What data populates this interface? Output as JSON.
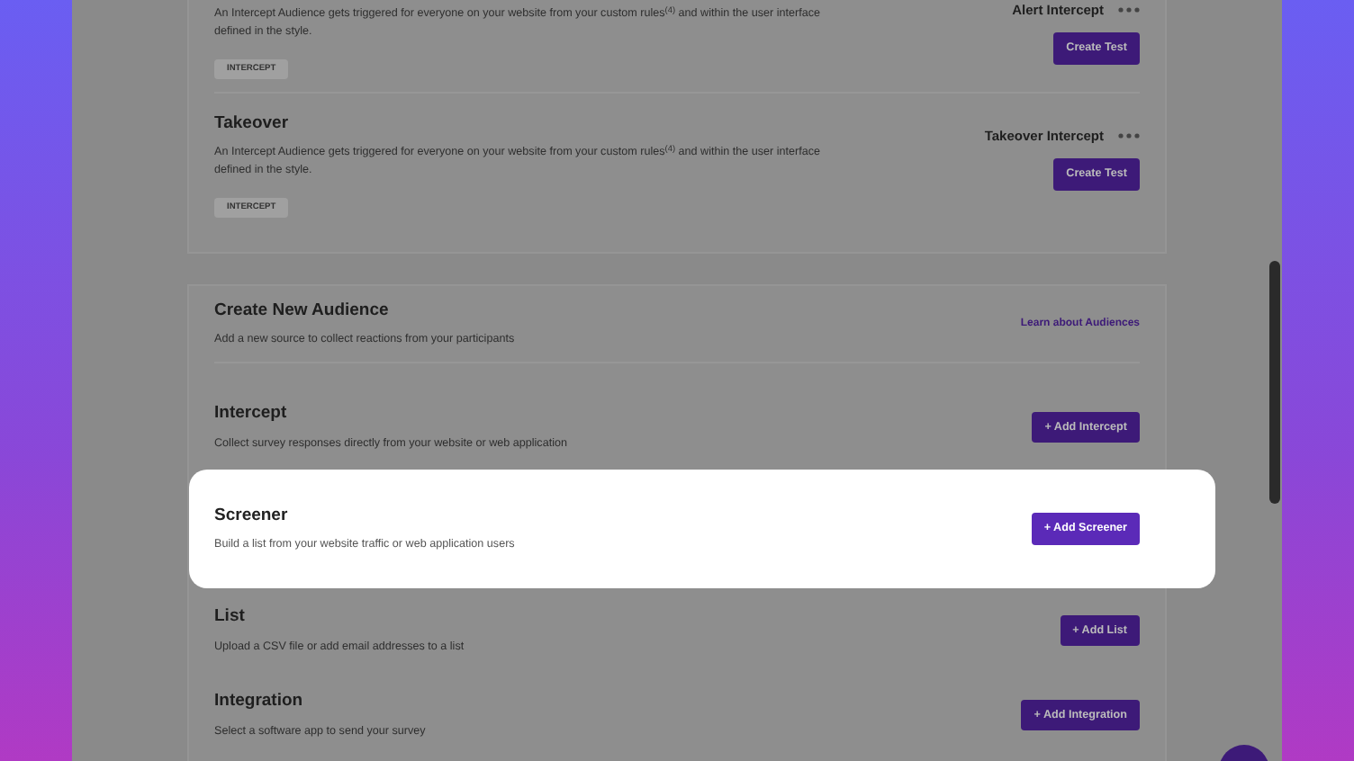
{
  "tests": [
    {
      "description": "An Intercept Audience gets triggered for everyone on your website from your custom rules$^{(4)}$ and within the user interface defined in the style.",
      "tag": "INTERCEPT",
      "name": "Alert Intercept",
      "button": "Create Test"
    },
    {
      "title": "Takeover",
      "description": "An Intercept Audience gets triggered for everyone on your website from your custom rules$^{(4)}$ and within the user interface defined in the style.",
      "tag": "INTERCEPT",
      "name": "Takeover Intercept",
      "button": "Create Test"
    }
  ],
  "audience": {
    "title": "Create New Audience",
    "subtitle": "Add a new source to collect reactions from your participants",
    "link": "Learn about Audiences",
    "sources": [
      {
        "title": "Intercept",
        "description": "Collect survey responses directly from your website or web application",
        "button": "+ Add Intercept",
        "highlighted": false
      },
      {
        "title": "Screener",
        "description": "Build a list from your website traffic or web application users",
        "button": "+ Add Screener",
        "highlighted": true
      },
      {
        "title": "List",
        "description": "Upload a CSV file or add email addresses to a list",
        "button": "+ Add List",
        "highlighted": false
      },
      {
        "title": "Integration",
        "description": "Select a software app to send your survey",
        "button": "+ Add Integration",
        "highlighted": false
      }
    ]
  }
}
